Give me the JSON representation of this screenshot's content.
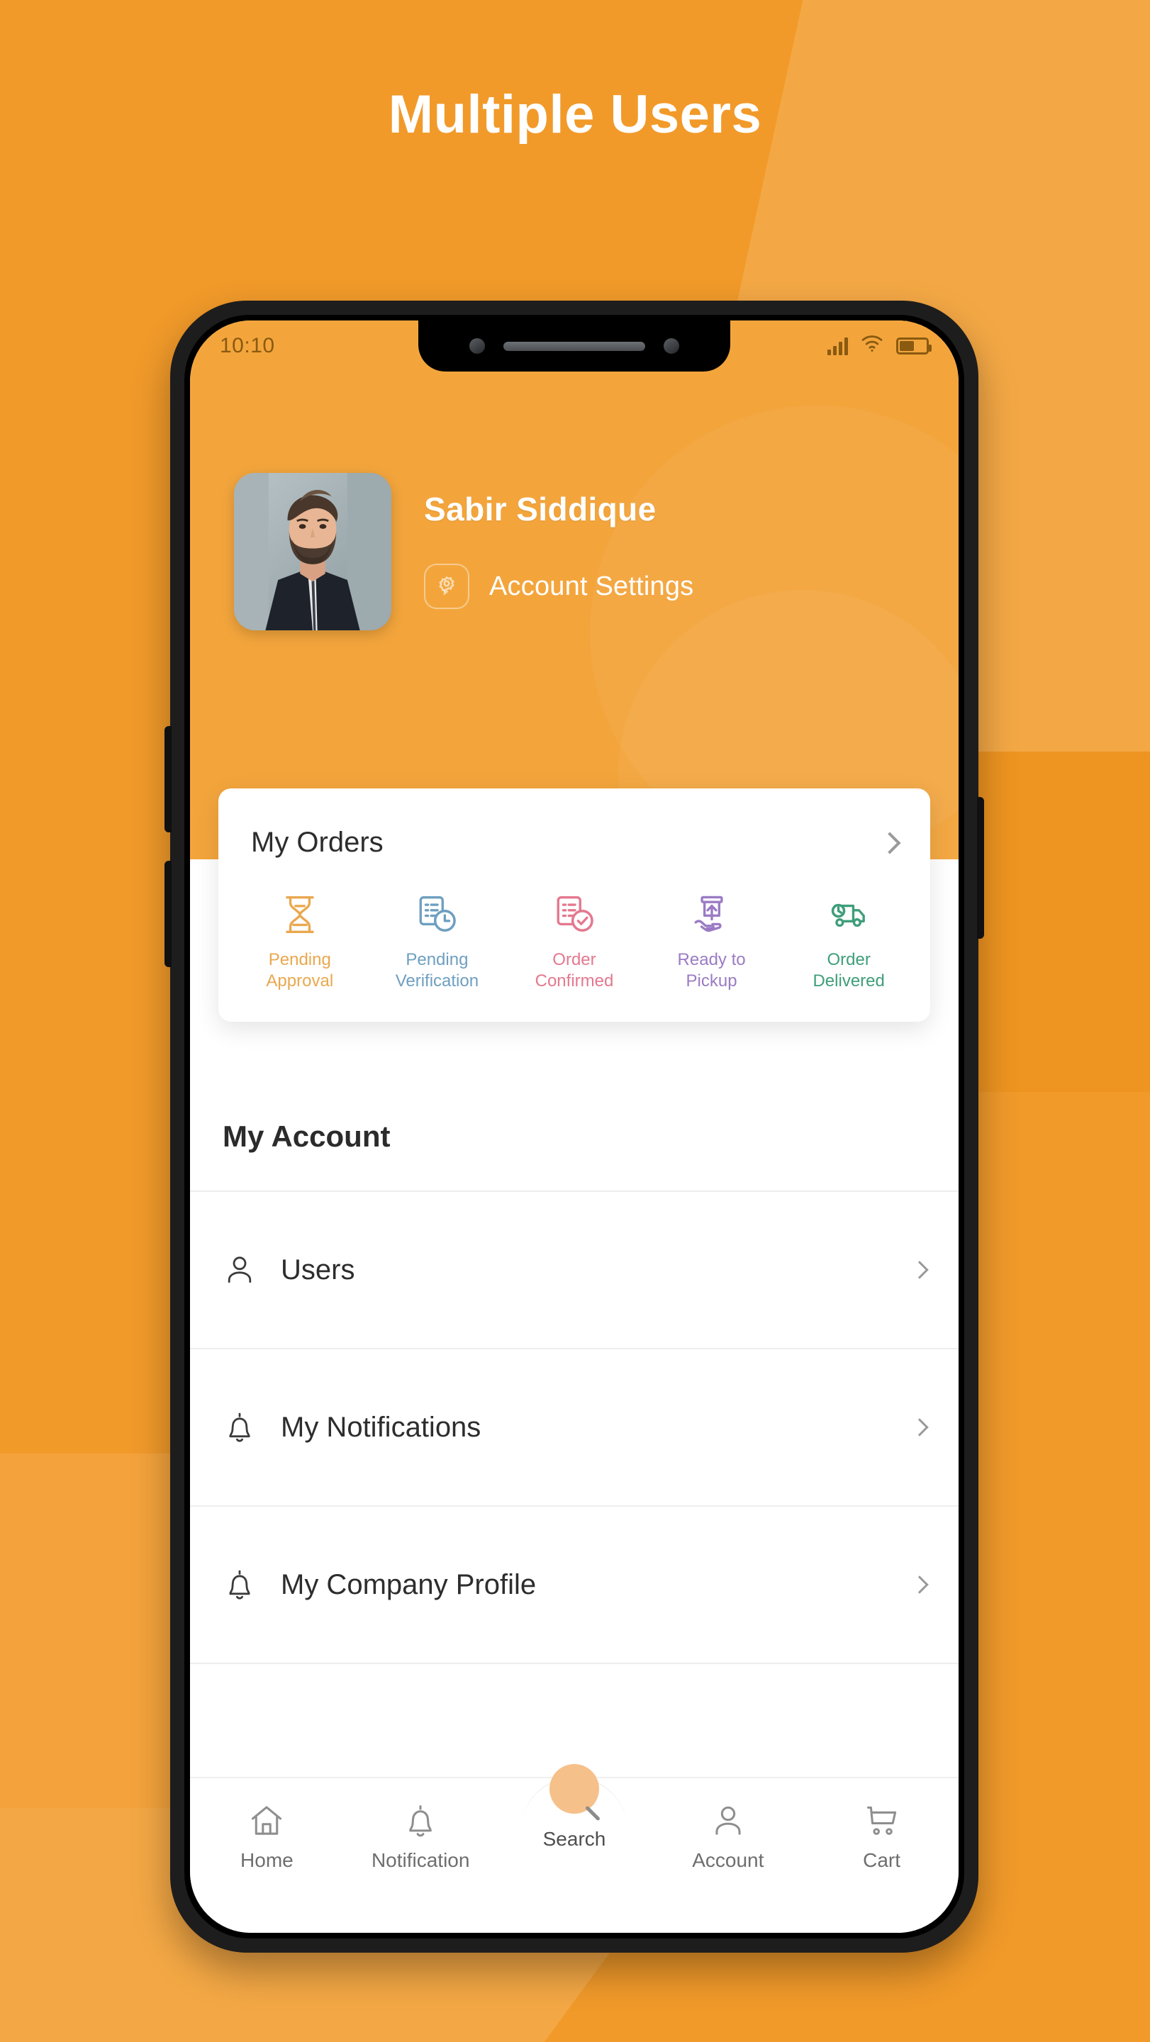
{
  "page": {
    "headline": "Multiple Users",
    "background_color": "#f19a2a",
    "accent_color": "#f3a53c"
  },
  "status_bar": {
    "time": "10:10",
    "signal_icon": "cellular-signal-icon",
    "wifi_icon": "wifi-icon",
    "battery_icon": "battery-icon"
  },
  "profile": {
    "avatar_icon": "user-photo-avatar",
    "name": "Sabir Siddique",
    "settings_label": "Account Settings",
    "settings_icon": "gear-icon"
  },
  "orders_card": {
    "title": "My Orders",
    "chevron_icon": "chevron-right-icon",
    "statuses": [
      {
        "label": "Pending\nApproval",
        "line1": "Pending",
        "line2": "Approval",
        "icon": "hourglass-icon",
        "color": "#eaa84f"
      },
      {
        "label": "Pending Verification",
        "line1": "Pending",
        "line2": "Verification",
        "icon": "clipboard-clock-icon",
        "color": "#6e9fc0"
      },
      {
        "label": "Order Confirmed",
        "line1": "Order",
        "line2": "Confirmed",
        "icon": "clipboard-check-icon",
        "color": "#e4788f"
      },
      {
        "label": "Ready to Pickup",
        "line1": "Ready to",
        "line2": "Pickup",
        "icon": "hand-package-icon",
        "color": "#9b7bc4"
      },
      {
        "label": "Order Delivered",
        "line1": "Order",
        "line2": "Delivered",
        "icon": "delivery-truck-icon",
        "color": "#3f9e7a"
      }
    ]
  },
  "account_section": {
    "heading": "My Account",
    "items": [
      {
        "label": "Users",
        "icon": "user-icon",
        "chevron": "chevron-right-icon"
      },
      {
        "label": "My Notifications",
        "icon": "bell-icon",
        "chevron": "chevron-right-icon"
      },
      {
        "label": "My Company Profile",
        "icon": "bell-icon",
        "chevron": "chevron-right-icon"
      }
    ]
  },
  "bottom_nav": {
    "items": [
      {
        "label": "Home",
        "icon": "home-icon"
      },
      {
        "label": "Notification",
        "icon": "bell-icon"
      },
      {
        "label": "Search",
        "icon": "search-icon"
      },
      {
        "label": "Account",
        "icon": "user-icon"
      },
      {
        "label": "Cart",
        "icon": "shopping-cart-icon"
      }
    ]
  }
}
